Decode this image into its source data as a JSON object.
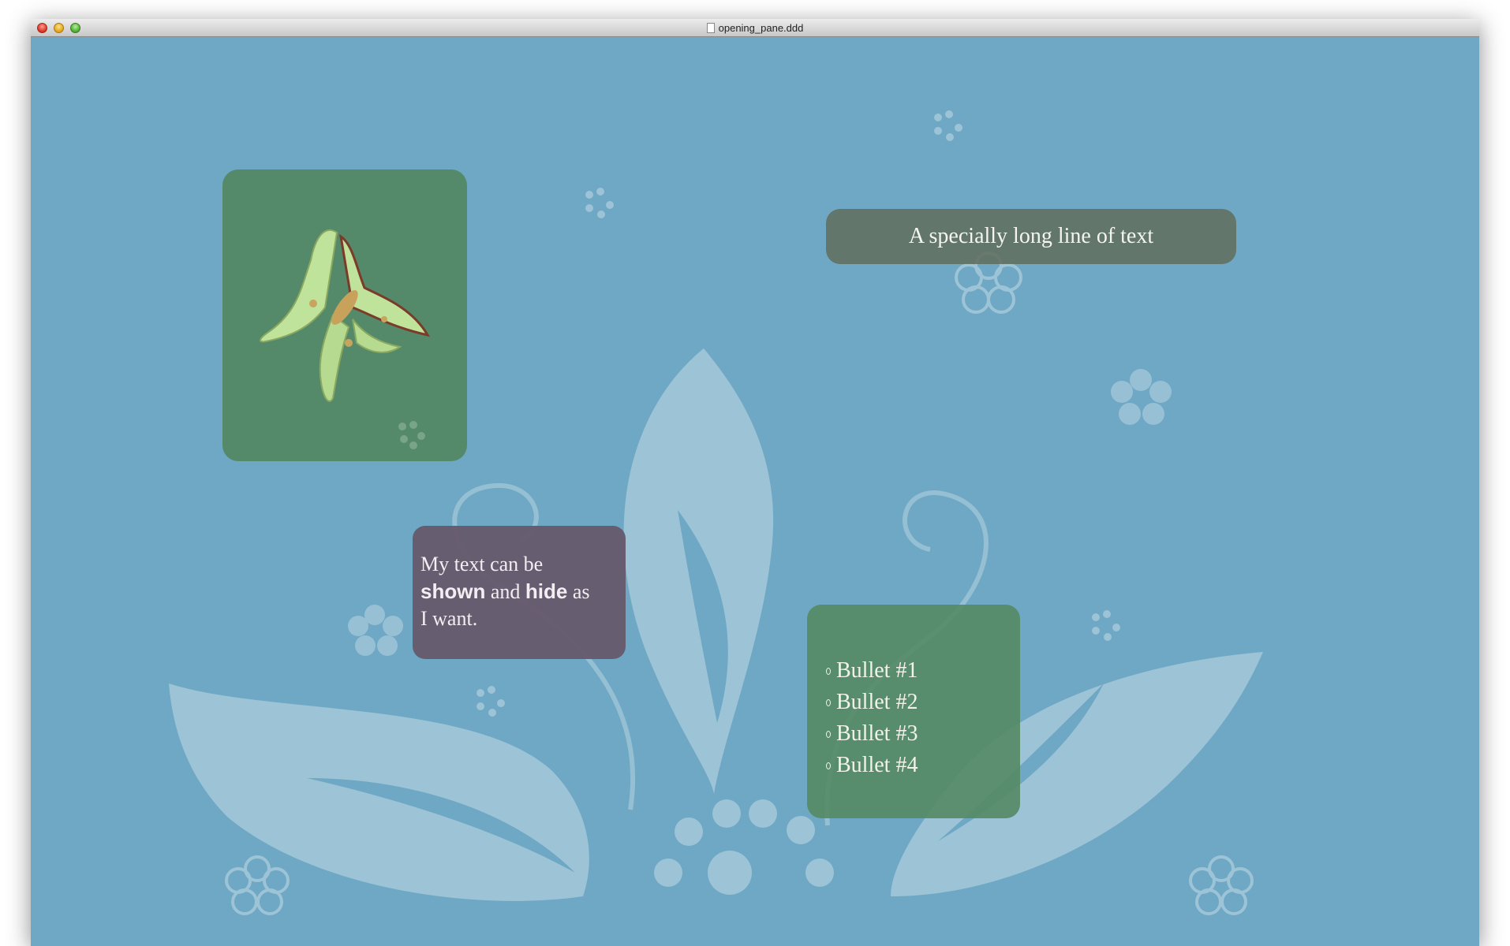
{
  "window": {
    "title": "opening_pane.ddd"
  },
  "slide": {
    "image": {
      "icon": "luna-moth-illustration"
    },
    "headline": "A specially long line of text",
    "text_block": {
      "part1": "My text can be",
      "bold1": "shown",
      "part2": "and",
      "bold2": "hide",
      "part3": "as",
      "part4": "I want."
    },
    "bullets": [
      "Bullet #1",
      "Bullet #2",
      "Bullet #3",
      "Bullet #4"
    ]
  },
  "colors": {
    "background": "#6fa8c4",
    "image_box": "#548a6a",
    "headline_box": "#626e5f",
    "text_box": "#66586c",
    "bullets_box": "#548a64"
  }
}
